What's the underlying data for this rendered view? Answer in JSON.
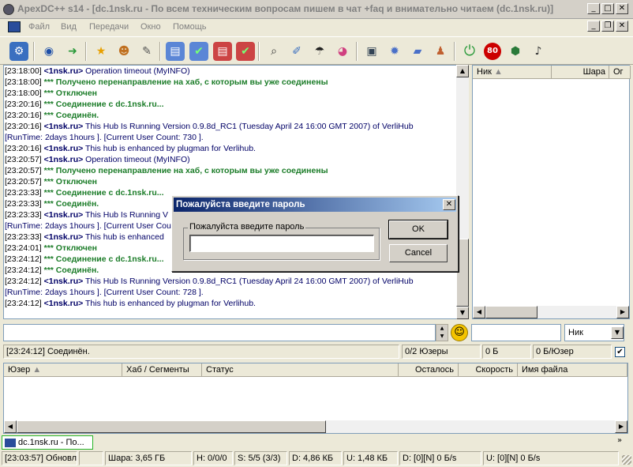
{
  "window": {
    "title": "ApexDC++ s14 - [dc.1nsk.ru - По всем техническим вопросам пишем в чат +faq и внимательно читаем (dc.1nsk.ru)]"
  },
  "menu": [
    "Файл",
    "Вид",
    "Передачи",
    "Окно",
    "Помощь"
  ],
  "toolbar": {
    "icons": [
      "connect-icon",
      "reconnect-icon",
      "follow-redirect-icon",
      "favorites-icon",
      "favorite-users-icon",
      "recent-hubs-icon",
      "queue-icon",
      "finished-icon",
      "upload-queue-icon",
      "finished-uploads-icon",
      "search-icon",
      "adl-search-icon",
      "search-spy-icon",
      "network-stats-icon",
      "notepad-icon",
      "settings-icon",
      "open-file-list-icon",
      "user-icon",
      "away-icon",
      "limiter-icon",
      "shutdown-icon",
      "speaker-icon"
    ]
  },
  "chat": {
    "lines": [
      [
        {
          "c": "ts",
          "t": "[23:18:00] "
        },
        {
          "c": "nick",
          "t": "<1nsk.ru>"
        },
        {
          "c": "msg",
          "t": " Operation timeout (MyINFO)"
        }
      ],
      [
        {
          "c": "ts",
          "t": "[23:18:00] "
        },
        {
          "c": "sys",
          "t": "*** Получено перенаправление на хаб, с которым вы уже соединены"
        }
      ],
      [
        {
          "c": "ts",
          "t": "[23:18:00] "
        },
        {
          "c": "sys",
          "t": "*** Отключен"
        }
      ],
      [
        {
          "c": "ts",
          "t": "[23:20:16] "
        },
        {
          "c": "sys",
          "t": "*** Соединение с dc.1nsk.ru..."
        }
      ],
      [
        {
          "c": "ts",
          "t": "[23:20:16] "
        },
        {
          "c": "sys",
          "t": "*** Соединён."
        }
      ],
      [
        {
          "c": "ts",
          "t": "[23:20:16] "
        },
        {
          "c": "nick",
          "t": "<1nsk.ru>"
        },
        {
          "c": "msg",
          "t": " This Hub Is Running Version 0.9.8d_RC1 (Tuesday April 24 16:00 GMT 2007) of VerliHub"
        }
      ],
      [
        {
          "c": "msg",
          "t": "[RunTime: 2days 1hours ]. [Current User Count: 730 ]."
        }
      ],
      [
        {
          "c": "ts",
          "t": "[23:20:16] "
        },
        {
          "c": "nick",
          "t": "<1nsk.ru>"
        },
        {
          "c": "msg",
          "t": " This hub is enhanced by plugman for Verlihub."
        }
      ],
      [
        {
          "c": "ts",
          "t": "[23:20:57] "
        },
        {
          "c": "nick",
          "t": "<1nsk.ru>"
        },
        {
          "c": "msg",
          "t": " Operation timeout (MyINFO)"
        }
      ],
      [
        {
          "c": "ts",
          "t": "[23:20:57] "
        },
        {
          "c": "sys",
          "t": "*** Получено перенаправление на хаб, с которым вы уже соединены"
        }
      ],
      [
        {
          "c": "ts",
          "t": "[23:20:57] "
        },
        {
          "c": "sys",
          "t": "*** Отключен"
        }
      ],
      [
        {
          "c": "ts",
          "t": "[23:23:33] "
        },
        {
          "c": "sys",
          "t": "*** Соединение с dc.1nsk.ru..."
        }
      ],
      [
        {
          "c": "ts",
          "t": "[23:23:33] "
        },
        {
          "c": "sys",
          "t": "*** Соединён."
        }
      ],
      [
        {
          "c": "ts",
          "t": "[23:23:33] "
        },
        {
          "c": "nick",
          "t": "<1nsk.ru>"
        },
        {
          "c": "msg",
          "t": " This Hub Is Running V"
        }
      ],
      [
        {
          "c": "msg",
          "t": "[RunTime: 2days 1hours ]. [Current User Cou"
        }
      ],
      [
        {
          "c": "ts",
          "t": "[23:23:33] "
        },
        {
          "c": "nick",
          "t": "<1nsk.ru>"
        },
        {
          "c": "msg",
          "t": " This hub is enhanced"
        }
      ],
      [
        {
          "c": "ts",
          "t": "[23:24:01] "
        },
        {
          "c": "sys",
          "t": "*** Отключен"
        }
      ],
      [
        {
          "c": "ts",
          "t": "[23:24:12] "
        },
        {
          "c": "sys",
          "t": "*** Соединение с dc.1nsk.ru..."
        }
      ],
      [
        {
          "c": "ts",
          "t": "[23:24:12] "
        },
        {
          "c": "sys",
          "t": "*** Соединён."
        }
      ],
      [
        {
          "c": "ts",
          "t": "[23:24:12] "
        },
        {
          "c": "nick",
          "t": "<1nsk.ru>"
        },
        {
          "c": "msg",
          "t": " This Hub Is Running Version 0.9.8d_RC1 (Tuesday April 24 16:00 GMT 2007) of VerliHub"
        }
      ],
      [
        {
          "c": "msg",
          "t": "[RunTime: 2days 1hours ]. [Current User Count: 728 ]."
        }
      ],
      [
        {
          "c": "ts",
          "t": "[23:24:12] "
        },
        {
          "c": "nick",
          "t": "<1nsk.ru>"
        },
        {
          "c": "msg",
          "t": " This hub is enhanced by plugman for Verlihub."
        }
      ]
    ]
  },
  "userlist": {
    "headers": [
      "Ник",
      "Шара",
      "Ог"
    ]
  },
  "nick_select": {
    "value": "Ник"
  },
  "hub_status": {
    "message": "[23:24:12] Соединён.",
    "users": "0/2 Юзеры",
    "share": "0 Б",
    "per_user": "0 Б/Юзер"
  },
  "transfers": {
    "headers": [
      "Юзер",
      "Хаб / Сегменты",
      "Статус",
      "Осталось",
      "Скорость",
      "Имя файла"
    ]
  },
  "tab": {
    "label": "dc.1nsk.ru - По..."
  },
  "statusbar": {
    "cells": [
      "[23:03:57] Обновл",
      "",
      "Шара: 3,65 ГБ",
      "H: 0/0/0",
      "S: 5/5 (3/3)",
      "D: 4,86 КБ",
      "U: 1,48 КБ",
      "D: [0][N] 0 Б/s",
      "U: [0][N] 0 Б/s"
    ]
  },
  "dialog": {
    "title": "Пожалуйста введите пароль",
    "group_label": "Пожалуйста введите пароль",
    "password_value": "",
    "ok_label": "OK",
    "cancel_label": "Cancel"
  }
}
